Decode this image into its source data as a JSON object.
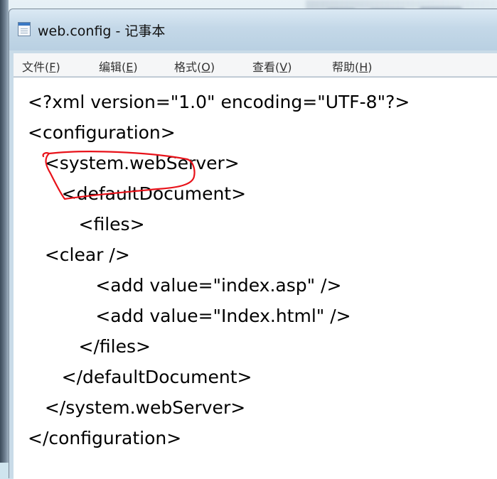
{
  "window": {
    "title": "web.config - 记事本"
  },
  "menu": {
    "items": [
      {
        "label": "文件(",
        "accel": "F",
        "suffix": ")"
      },
      {
        "label": "编辑(",
        "accel": "E",
        "suffix": ")"
      },
      {
        "label": "格式(",
        "accel": "O",
        "suffix": ")"
      },
      {
        "label": "查看(",
        "accel": "V",
        "suffix": ")"
      },
      {
        "label": "帮助(",
        "accel": "H",
        "suffix": ")"
      }
    ]
  },
  "editor": {
    "lines": [
      "<?xml version=\"1.0\" encoding=\"UTF-8\"?>",
      "<configuration>",
      "   <system.webServer>",
      "      <defaultDocument>",
      "         <files>",
      "   <clear />",
      "            <add value=\"index.asp\" />",
      "            <add value=\"Index.html\" />",
      "         </files>",
      "      </defaultDocument>",
      "   </system.webServer>",
      "</configuration>"
    ]
  },
  "colors": {
    "annotation": "#e8121a"
  },
  "icons": {
    "title": "notepad-icon"
  }
}
